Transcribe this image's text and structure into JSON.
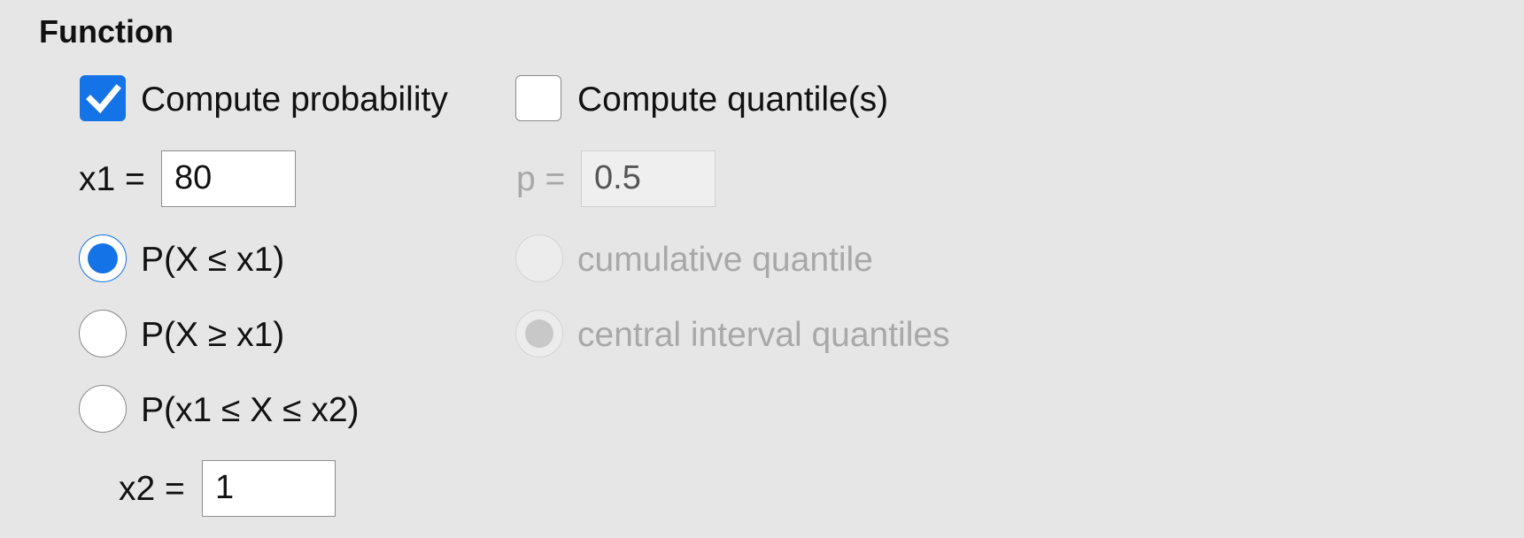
{
  "section": {
    "title": "Function"
  },
  "probability": {
    "checkbox_label": "Compute probability",
    "checked": true,
    "x1_label": "x1 =",
    "x1_value": "80",
    "options": [
      {
        "label": "P(X ≤ x1)",
        "selected": true
      },
      {
        "label": "P(X ≥ x1)",
        "selected": false
      },
      {
        "label": "P(x1 ≤ X ≤ x2)",
        "selected": false
      }
    ],
    "x2_label": "x2 =",
    "x2_value": "1"
  },
  "quantile": {
    "checkbox_label": "Compute quantile(s)",
    "checked": false,
    "p_label": "p =",
    "p_value": "0.5",
    "options": [
      {
        "label": "cumulative quantile",
        "selected": false
      },
      {
        "label": "central interval quantiles",
        "selected": true
      }
    ]
  },
  "colors": {
    "accent": "#1473e6",
    "background": "#e6e6e6",
    "disabled_text": "#a8a8a8"
  }
}
